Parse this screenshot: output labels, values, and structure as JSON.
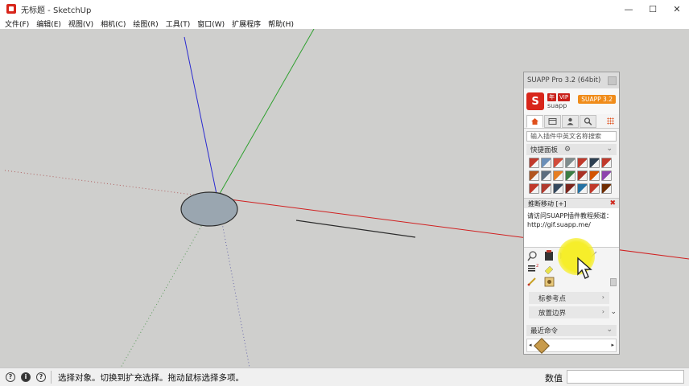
{
  "window": {
    "title": "无标题 - SketchUp",
    "controls": [
      "—",
      "☐",
      "✕"
    ]
  },
  "menu": [
    "文件(F)",
    "编辑(E)",
    "视图(V)",
    "相机(C)",
    "绘图(R)",
    "工具(T)",
    "窗口(W)",
    "扩展程序",
    "帮助(H)"
  ],
  "plugin_panel": {
    "title": "SUAPP Pro 3.2 (64bit)",
    "brand_badges": [
      "年",
      "VIP"
    ],
    "brand_name": "suapp",
    "version_badge": "SUAPP 3.2",
    "tabs": [
      "home-icon",
      "window-icon",
      "user-icon",
      "search-icon"
    ],
    "search_placeholder": "输入插件中英文名称搜索",
    "quick_panel_label": "快捷面板",
    "tool_colors": [
      "#c0392b",
      "#6b8fb8",
      "#d14b3a",
      "#7f8c8d",
      "#c0392b",
      "#2c3e50",
      "#c0392b",
      "#b2551f",
      "#5d6d7e",
      "#e67e22",
      "#3a7d44",
      "#a93226",
      "#d35400",
      "#8e44ad",
      "#c0392b",
      "#b03a2e",
      "#34495e",
      "#7b241c",
      "#2471a3",
      "#c0392b",
      "#6e2c00"
    ],
    "tip": {
      "title": "推断移动 [+]",
      "text": "请访问SUAPP插件教程频道：http://gif.suapp.me/"
    },
    "rows": [
      {
        "label": "标参考点",
        "chev": "›"
      },
      {
        "label": "放置边界",
        "chev": "›"
      }
    ],
    "recent_label": "最近命令"
  },
  "status": {
    "message": "选择对象。切换到扩充选择。拖动鼠标选择多项。",
    "value_label": "数值",
    "value": ""
  }
}
